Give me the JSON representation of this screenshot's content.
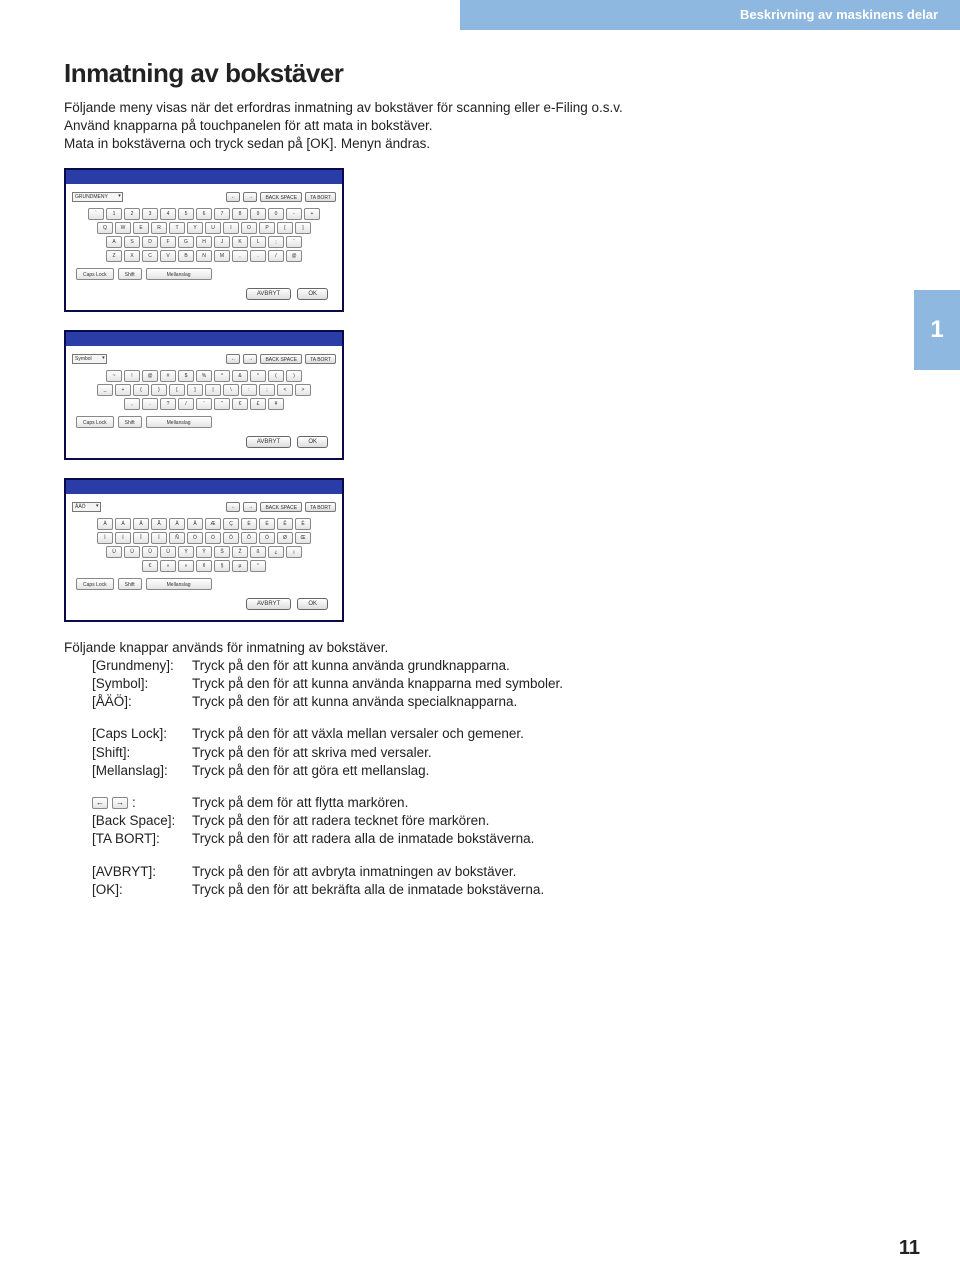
{
  "header": {
    "section_title": "Beskrivning av maskinens delar"
  },
  "chapter": {
    "number": "1"
  },
  "page": {
    "number": "11"
  },
  "content": {
    "title": "Inmatning av bokstäver",
    "intro_line1": "Följande meny visas när det erfordras inmatning av bokstäver för scanning eller e-Filing o.s.v.",
    "intro_line2": "Använd knapparna på touchpanelen för att mata in bokstäver.",
    "intro_line3": "Mata in bokstäverna och tryck sedan på [OK]. Menyn ändras."
  },
  "keyboards": {
    "common": {
      "arrow_left": "←",
      "arrow_right": "→",
      "back_space": "BACK SPACE",
      "ta_bort": "TA BORT",
      "caps_lock": "Caps Lock",
      "shift": "Shift",
      "mellanslag": "Mellanslag",
      "avbryt": "AVBRYT",
      "ok": "OK"
    },
    "kbd1": {
      "mode": "GRUNDMENY",
      "rows": [
        [
          "`",
          "1",
          "2",
          "3",
          "4",
          "5",
          "6",
          "7",
          "8",
          "9",
          "0",
          "-",
          "+"
        ],
        [
          "Q",
          "W",
          "E",
          "R",
          "T",
          "Y",
          "U",
          "I",
          "O",
          "P",
          "[",
          "]"
        ],
        [
          "A",
          "S",
          "D",
          "F",
          "G",
          "H",
          "J",
          "K",
          "L",
          ";",
          "'"
        ],
        [
          "Z",
          "X",
          "C",
          "V",
          "B",
          "N",
          "M",
          ",",
          ".",
          "/",
          "@"
        ]
      ]
    },
    "kbd2": {
      "mode": "Symbol",
      "rows": [
        [
          "~",
          "!",
          "@",
          "#",
          "$",
          "%",
          "^",
          "&",
          "*",
          "(",
          ")"
        ],
        [
          "_",
          "+",
          "{",
          "}",
          "[",
          "]",
          "|",
          "\\",
          ":",
          ";",
          "<",
          ">"
        ],
        [
          ",",
          ".",
          "?",
          "/",
          "'",
          "\"",
          "€",
          "£",
          "¥"
        ]
      ]
    },
    "kbd3": {
      "mode": "ÅÄÖ",
      "rows": [
        [
          "À",
          "Á",
          "Â",
          "Ã",
          "Ä",
          "Å",
          "Æ",
          "Ç",
          "È",
          "É",
          "Ê",
          "Ë"
        ],
        [
          "Ì",
          "Í",
          "Î",
          "Ï",
          "Ñ",
          "Ò",
          "Ó",
          "Ô",
          "Õ",
          "Ö",
          "Ø",
          "Œ"
        ],
        [
          "Ù",
          "Ú",
          "Û",
          "Ü",
          "Ý",
          "Ÿ",
          "Š",
          "Ž",
          "ß",
          "¿",
          "¡"
        ],
        [
          "€",
          "«",
          "»",
          "¢",
          "§",
          "µ",
          "°"
        ]
      ]
    }
  },
  "defs": {
    "lead": "Följande knappar används för inmatning av bokstäver.",
    "g1": {
      "grundmeny_lbl": "[Grundmeny]:",
      "grundmeny_txt": "Tryck på den för att kunna använda grundknapparna.",
      "symbol_lbl": "[Symbol]:",
      "symbol_txt": "Tryck på den för att kunna använda knapparna med symboler.",
      "aao_lbl": "[ÅÄÖ]:",
      "aao_txt": "Tryck på den för att kunna använda specialknapparna."
    },
    "g2": {
      "caps_lbl": "[Caps Lock]:",
      "caps_txt": "Tryck på den för att växla mellan versaler och gemener.",
      "shift_lbl": "[Shift]:",
      "shift_txt": "Tryck på den för att skriva med versaler.",
      "space_lbl": "[Mellanslag]:",
      "space_txt": "Tryck på den för att göra ett mellanslag."
    },
    "g3": {
      "arrows_colon": ":",
      "arrows_txt": "Tryck på dem för att flytta markören.",
      "bs_lbl": "[Back Space]:",
      "bs_txt": "Tryck på den för att radera tecknet före markören.",
      "del_lbl": "[TA BORT]:",
      "del_txt": "Tryck på den för att radera alla de inmatade bokstäverna."
    },
    "g4": {
      "cancel_lbl": "[AVBRYT]:",
      "cancel_txt": "Tryck på den för att avbryta inmatningen av bokstäver.",
      "ok_lbl": "[OK]:",
      "ok_txt": "Tryck på den för att bekräfta alla de inmatade bokstäverna."
    }
  }
}
